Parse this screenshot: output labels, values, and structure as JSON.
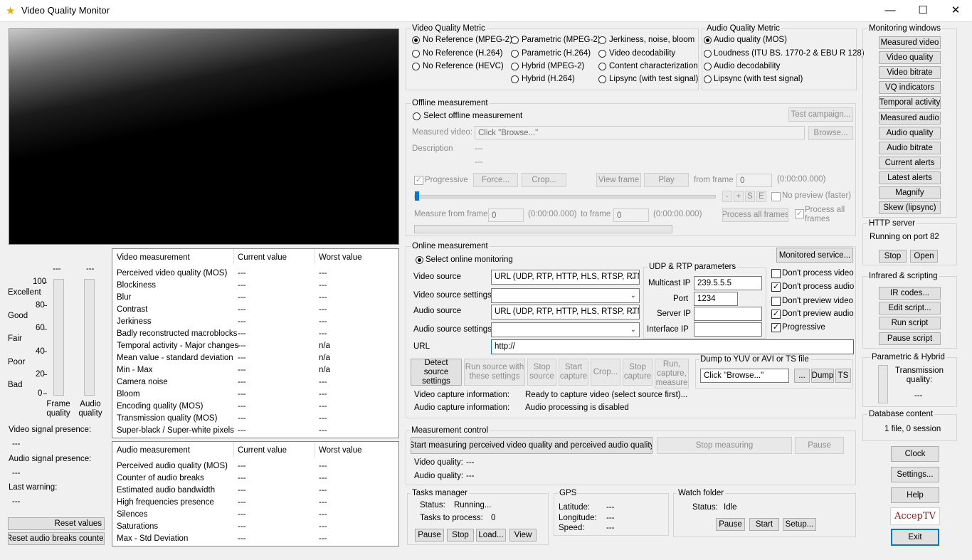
{
  "window": {
    "title": "Video Quality Monitor"
  },
  "vq_metric": {
    "title": "Video Quality Metric",
    "options": [
      "No Reference (MPEG-2)",
      "No Reference (H.264)",
      "No Reference (HEVC)",
      "Parametric (MPEG-2)",
      "Parametric (H.264)",
      "Hybrid (MPEG-2)",
      "Hybrid (H.264)",
      "Jerkiness, noise, bloom",
      "Video decodability",
      "Content characterization",
      "Lipsync (with test signal)"
    ],
    "selected": "No Reference (MPEG-2)"
  },
  "aq_metric": {
    "title": "Audio Quality Metric",
    "options": [
      "Audio quality (MOS)",
      "Loudness (ITU BS. 1770-2 & EBU R 128)",
      "Audio decodability",
      "Lipsync (with test signal)"
    ],
    "selected": "Audio quality (MOS)"
  },
  "monitoring_windows": {
    "title": "Monitoring windows",
    "buttons": [
      "Measured video",
      "Video quality",
      "Video bitrate",
      "VQ indicators",
      "Temporal activity",
      "Measured audio",
      "Audio quality",
      "Audio bitrate",
      "Current alerts",
      "Latest alerts",
      "Magnify",
      "Skew (lipsync)"
    ]
  },
  "http_server": {
    "title": "HTTP server",
    "status": "Running on port 82",
    "stop": "Stop",
    "open": "Open"
  },
  "infrared": {
    "title": "Infrared & scripting",
    "buttons": [
      "IR codes...",
      "Edit script...",
      "Run script",
      "Pause script"
    ]
  },
  "param_hybrid": {
    "title": "Parametric & Hybrid",
    "tq_label": "Transmission quality:",
    "tq_value": "---"
  },
  "database": {
    "title": "Database content",
    "value": "1 file, 0 session"
  },
  "right_buttons": {
    "clock": "Clock",
    "settings": "Settings...",
    "help": "Help",
    "logo": "AccepTV",
    "exit": "Exit"
  },
  "offline": {
    "title": "Offline measurement",
    "select": "Select offline measurement",
    "test_campaign": "Test campaign...",
    "measured_video_label": "Measured video:",
    "measured_video_value": "Click \"Browse...\"",
    "browse": "Browse...",
    "description_label": "Description",
    "desc1": "---",
    "desc2": "---",
    "progressive": "Progressive",
    "force": "Force...",
    "crop": "Crop...",
    "view_frame": "View frame",
    "play": "Play",
    "from_frame_label": "from frame",
    "from_frame_value": "0",
    "from_frame_time": "(0:00:00.000)",
    "nav_buttons": [
      "-",
      "+",
      "S",
      "E"
    ],
    "no_preview": "No preview (faster)",
    "measure_from_label": "Measure from frame",
    "measure_from_value": "0",
    "measure_from_time": "(0:00:00.000)",
    "to_frame_label": "to frame",
    "to_frame_value": "0",
    "to_frame_time": "(0:00:00.000)",
    "process_all": "Process all frames",
    "process_all_chk": "Process all frames"
  },
  "online": {
    "title": "Online measurement",
    "select": "Select online monitoring",
    "monitored_service": "Monitored service...",
    "video_source_label": "Video source",
    "video_source_value": "URL (UDP, RTP, HTTP, HLS, RTSP, RTM",
    "video_settings_label": "Video source settings",
    "audio_source_label": "Audio source",
    "audio_source_value": "URL (UDP, RTP, HTTP, HLS, RTSP, RTM",
    "audio_settings_label": "Audio source settings",
    "url_label": "URL",
    "url_value": "http://",
    "udp": {
      "title": "UDP & RTP parameters",
      "multicast_label": "Multicast IP",
      "multicast_value": "239.5.5.5",
      "port_label": "Port",
      "port_value": "1234",
      "server_label": "Server IP",
      "interface_label": "Interface IP"
    },
    "checks": [
      {
        "label": "Don't process video",
        "checked": false
      },
      {
        "label": "Don't process audio",
        "checked": true
      },
      {
        "label": "Don't preview video",
        "checked": false
      },
      {
        "label": "Don't preview audio",
        "checked": true
      },
      {
        "label": "Progressive",
        "checked": true
      }
    ],
    "detect": "Detect source settings",
    "run_source": "Run source with these settings",
    "stop_source": "Stop source",
    "start_capture": "Start capture",
    "crop": "Crop...",
    "stop_capture": "Stop capture",
    "run_capture": "Run, capture, measure",
    "dump": {
      "title": "Dump to YUV or AVI or TS file",
      "value": "Click \"Browse...\"",
      "browse": "...",
      "dump": "Dump",
      "ts": "TS"
    },
    "video_capture_label": "Video capture information:",
    "video_capture_value": "Ready to capture video (select source first)...",
    "audio_capture_label": "Audio capture information:",
    "audio_capture_value": "Audio processing is disabled"
  },
  "measurement_control": {
    "title": "Measurement control",
    "start": "Start measuring perceived video quality and perceived audio quality",
    "stop": "Stop measuring",
    "pause": "Pause",
    "vq_label": "Video quality:",
    "vq_value": "---",
    "aq_label": "Audio quality:",
    "aq_value": "---"
  },
  "tasks": {
    "title": "Tasks manager",
    "status_label": "Status:",
    "status_value": "Running...",
    "tasks_label": "Tasks to process:",
    "tasks_value": "0",
    "pause": "Pause",
    "stop": "Stop",
    "load": "Load...",
    "view": "View"
  },
  "gps": {
    "title": "GPS",
    "lat_label": "Latitude:",
    "lat_value": "---",
    "lon_label": "Longitude:",
    "lon_value": "---",
    "speed_label": "Speed:",
    "speed_value": "---"
  },
  "watch": {
    "title": "Watch folder",
    "status_label": "Status:",
    "status_value": "Idle",
    "pause": "Pause",
    "start": "Start",
    "setup": "Setup..."
  },
  "gauges": {
    "frame_value": "---",
    "audio_value": "---",
    "scale": [
      "100",
      "80",
      "60",
      "40",
      "20",
      "0"
    ],
    "grades": [
      "Excellent",
      "Good",
      "Fair",
      "Poor",
      "Bad"
    ],
    "frame_label": "Frame quality",
    "audio_label": "Audio quality"
  },
  "left_info": {
    "video_presence_label": "Video signal presence:",
    "video_presence_value": "---",
    "audio_presence_label": "Audio signal presence:",
    "audio_presence_value": "---",
    "last_warning_label": "Last warning:",
    "last_warning_value": "---",
    "reset_values": "Reset values",
    "reset_breaks": "Reset audio breaks counter"
  },
  "video_table": {
    "headers": [
      "Video measurement",
      "Current value",
      "Worst value"
    ],
    "rows": [
      [
        "Perceived video quality (MOS)",
        "---",
        "---"
      ],
      [
        "Blockiness",
        "---",
        "---"
      ],
      [
        "Blur",
        "---",
        "---"
      ],
      [
        "Contrast",
        "---",
        "---"
      ],
      [
        "Jerkiness",
        "---",
        "---"
      ],
      [
        "Badly reconstructed macroblocks",
        "---",
        "---"
      ],
      [
        "Temporal activity - Major changes",
        "---",
        "n/a"
      ],
      [
        "Mean value - standard deviation",
        "---",
        "n/a"
      ],
      [
        "Min - Max",
        "---",
        "n/a"
      ],
      [
        "Camera noise",
        "---",
        "---"
      ],
      [
        "Bloom",
        "---",
        "---"
      ],
      [
        "Encoding quality (MOS)",
        "---",
        "---"
      ],
      [
        "Transmission quality (MOS)",
        "---",
        "---"
      ],
      [
        "Super-black / Super-white pixels",
        "---",
        "---"
      ]
    ]
  },
  "audio_table": {
    "headers": [
      "Audio measurement",
      "Current value",
      "Worst value"
    ],
    "rows": [
      [
        "Perceived audio quality (MOS)",
        "---",
        "---"
      ],
      [
        "Counter of audio breaks",
        "---",
        "---"
      ],
      [
        "Estimated audio bandwidth",
        "---",
        "---"
      ],
      [
        "High frequencies presence",
        "---",
        "---"
      ],
      [
        "Silences",
        "---",
        "---"
      ],
      [
        "Saturations",
        "---",
        "---"
      ],
      [
        "Max - Std Deviation",
        "---",
        "---"
      ]
    ]
  }
}
